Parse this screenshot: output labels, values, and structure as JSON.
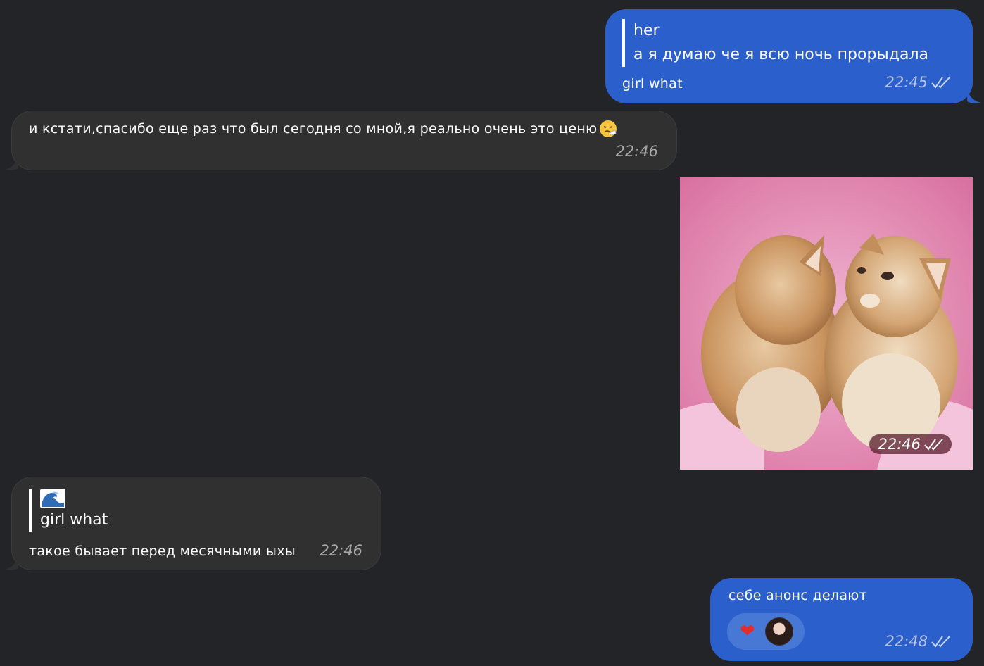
{
  "messages": [
    {
      "id": "m1",
      "direction": "outgoing",
      "reply": {
        "title": "her",
        "text": "а я думаю че я всю ночь прорыдала"
      },
      "text": "girl what",
      "time": "22:45",
      "status": "read"
    },
    {
      "id": "m2",
      "direction": "incoming",
      "text": "и кстати,спасибо еще раз что был сегодня со мной,я реально очень это ценю",
      "emoji": "sneezing-face",
      "time": "22:46"
    },
    {
      "id": "m3",
      "direction": "outgoing",
      "type": "photo",
      "photo_subject": "two-kittens-kissing",
      "time": "22:46",
      "status": "read"
    },
    {
      "id": "m4",
      "direction": "incoming",
      "reply": {
        "title_emoji": "water-wave",
        "text": "girl what"
      },
      "text": "такое бывает перед месячными ыхы",
      "time": "22:46"
    },
    {
      "id": "m5",
      "direction": "outgoing",
      "text": "себе анонс делают",
      "reactions": [
        {
          "icon": "red-heart",
          "glyph": "❤"
        }
      ],
      "time": "22:48",
      "status": "read"
    }
  ],
  "colors": {
    "background": "#222427",
    "outgoing_bubble": "#2b5fcb",
    "incoming_bubble": "#303030"
  }
}
